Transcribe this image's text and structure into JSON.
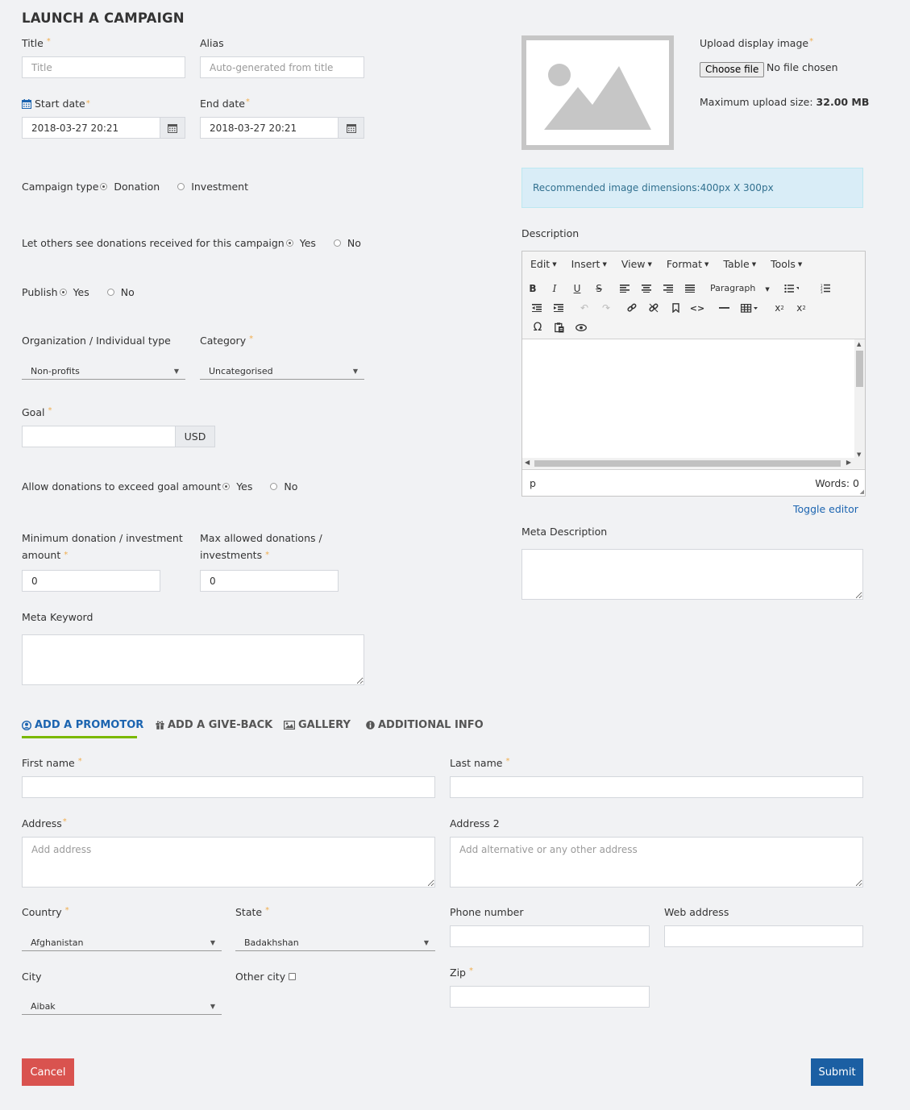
{
  "page_title": "LAUNCH A CAMPAIGN",
  "colors": {
    "accent_blue": "#1b64b0",
    "tab_underline": "#7ab800",
    "cancel": "#d9534f",
    "submit": "#1b5fa3",
    "required": "#f0ad4e"
  },
  "fields": {
    "title": {
      "label": "Title",
      "placeholder": "Title"
    },
    "alias": {
      "label": "Alias",
      "placeholder": "Auto-generated from title"
    },
    "start_date": {
      "label": "Start date",
      "value": "2018-03-27 20:21"
    },
    "end_date": {
      "label": "End date",
      "value": "2018-03-27 20:21"
    },
    "campaign_type": {
      "label": "Campaign type",
      "options": [
        "Donation",
        "Investment"
      ],
      "selected": "Donation"
    },
    "show_donations": {
      "label": "Let others see donations received for this campaign",
      "options": [
        "Yes",
        "No"
      ],
      "selected": "Yes"
    },
    "publish": {
      "label": "Publish",
      "options": [
        "Yes",
        "No"
      ],
      "selected": "Yes"
    },
    "org_type": {
      "label": "Organization / Individual type",
      "value": "Non-profits"
    },
    "category": {
      "label": "Category",
      "value": "Uncategorised"
    },
    "goal": {
      "label": "Goal",
      "value": "",
      "currency": "USD"
    },
    "exceed_goal": {
      "label": "Allow donations to exceed goal amount",
      "options": [
        "Yes",
        "No"
      ],
      "selected": "Yes"
    },
    "min_donation": {
      "label_line1": "Minimum donation / investment",
      "label_line2": "amount",
      "value": "0"
    },
    "max_donations": {
      "label_line1": "Max allowed donations /",
      "label_line2": "investments",
      "value": "0"
    },
    "meta_keyword": {
      "label": "Meta Keyword",
      "value": ""
    },
    "meta_description": {
      "label": "Meta Description",
      "value": ""
    }
  },
  "image_upload": {
    "label": "Upload display image",
    "button": "Choose file",
    "status": "No file chosen",
    "max_size_label": "Maximum upload size:",
    "max_size_value": "32.00 MB",
    "recommendation": "Recommended image dimensions:400px X 300px"
  },
  "editor": {
    "label": "Description",
    "menus": [
      "Edit",
      "Insert",
      "View",
      "Format",
      "Table",
      "Tools"
    ],
    "block_format": "Paragraph",
    "path": "p",
    "words": "Words: 0",
    "toggle": "Toggle editor",
    "toolbar_icons": [
      "bold-icon",
      "italic-icon",
      "underline-icon",
      "strikethrough-icon",
      "align-left-icon",
      "align-center-icon",
      "align-right-icon",
      "align-justify-icon",
      "bullet-list-icon",
      "numbered-list-icon",
      "outdent-icon",
      "indent-icon",
      "undo-icon",
      "redo-icon",
      "link-icon",
      "unlink-icon",
      "bookmark-icon",
      "code-icon",
      "horizontal-rule-icon",
      "table-icon",
      "subscript-icon",
      "superscript-icon",
      "special-char-icon",
      "paste-text-icon",
      "preview-icon"
    ]
  },
  "tabs": [
    {
      "label": "ADD A PROMOTOR",
      "icon": "user-circle-icon",
      "active": true
    },
    {
      "label": "ADD A GIVE-BACK",
      "icon": "gift-icon",
      "active": false
    },
    {
      "label": "GALLERY",
      "icon": "image-icon",
      "active": false
    },
    {
      "label": "ADDITIONAL INFO",
      "icon": "info-circle-icon",
      "active": false
    }
  ],
  "promotor": {
    "first_name": {
      "label": "First name",
      "value": ""
    },
    "last_name": {
      "label": "Last name",
      "value": ""
    },
    "address": {
      "label": "Address",
      "placeholder": "Add address"
    },
    "address2": {
      "label": "Address 2",
      "placeholder": "Add alternative or any other address"
    },
    "country": {
      "label": "Country",
      "value": "Afghanistan"
    },
    "state": {
      "label": "State",
      "value": "Badakhshan"
    },
    "phone": {
      "label": "Phone number",
      "value": ""
    },
    "web": {
      "label": "Web address",
      "value": ""
    },
    "city": {
      "label": "City",
      "value": "Aibak"
    },
    "other_city": {
      "label": "Other city"
    },
    "zip": {
      "label": "Zip",
      "value": ""
    }
  },
  "actions": {
    "cancel": "Cancel",
    "submit": "Submit"
  }
}
